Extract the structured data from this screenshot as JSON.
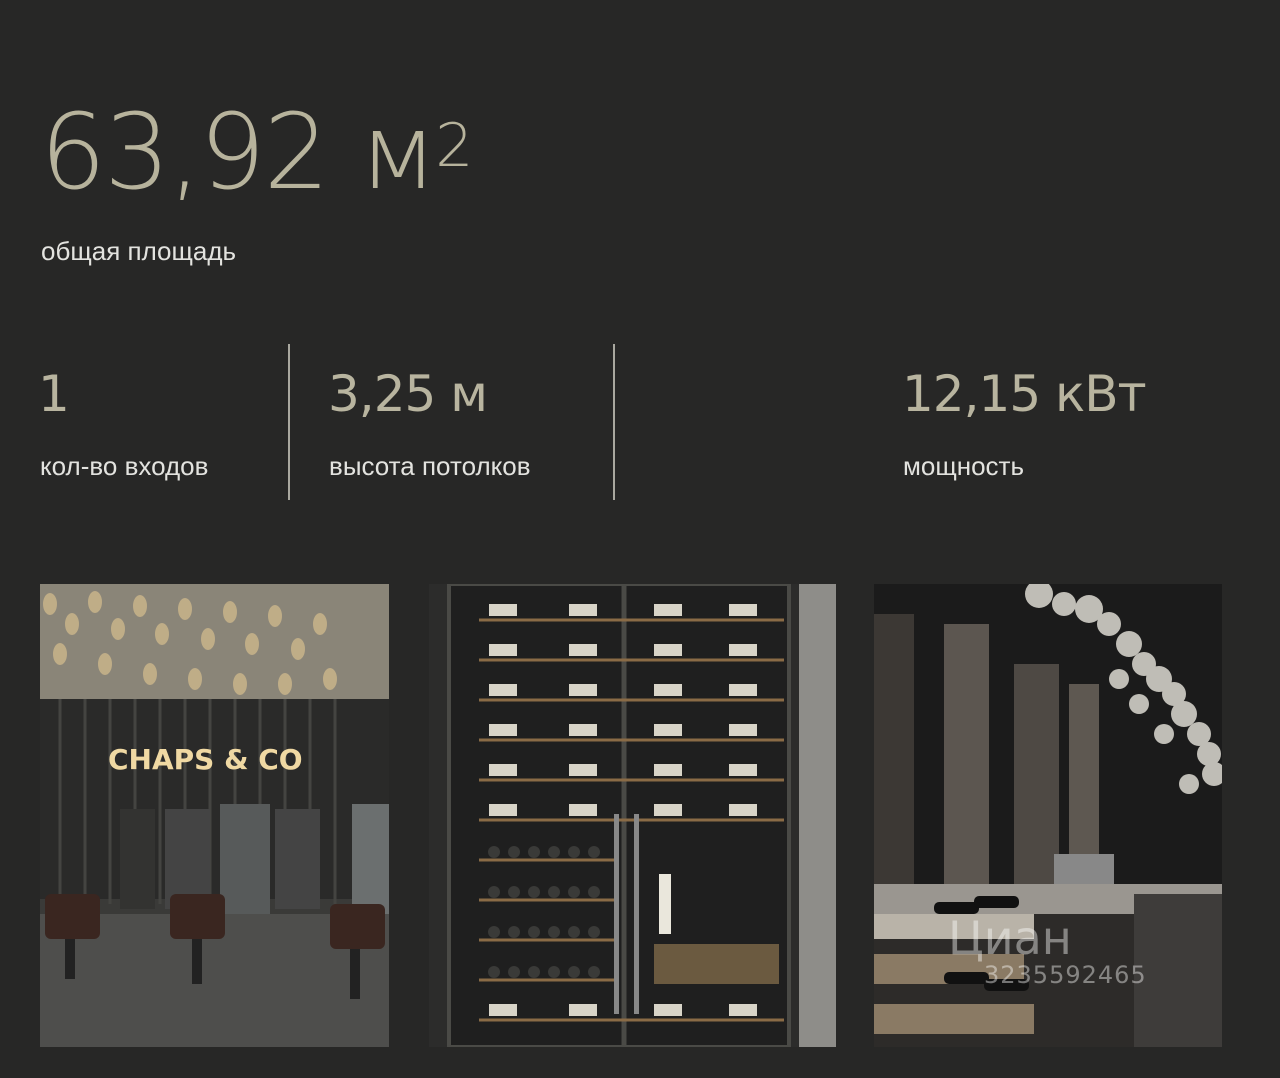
{
  "area": {
    "value": "63,92 м",
    "unit_sup": "2",
    "label": "общая площадь"
  },
  "stats": [
    {
      "value": "1",
      "label": "кол-во входов"
    },
    {
      "value": "3,25 м",
      "label": "высота потолков"
    },
    {
      "value": "12,15 кВт",
      "label": "мощность"
    }
  ],
  "photos": [
    {
      "sign": "CHAPS & CO"
    }
  ],
  "watermark": {
    "brand": "Циан",
    "id": "3235592465"
  },
  "colors": {
    "background": "#272726",
    "accent": "#b7b39c",
    "text": "#e3e3df"
  }
}
